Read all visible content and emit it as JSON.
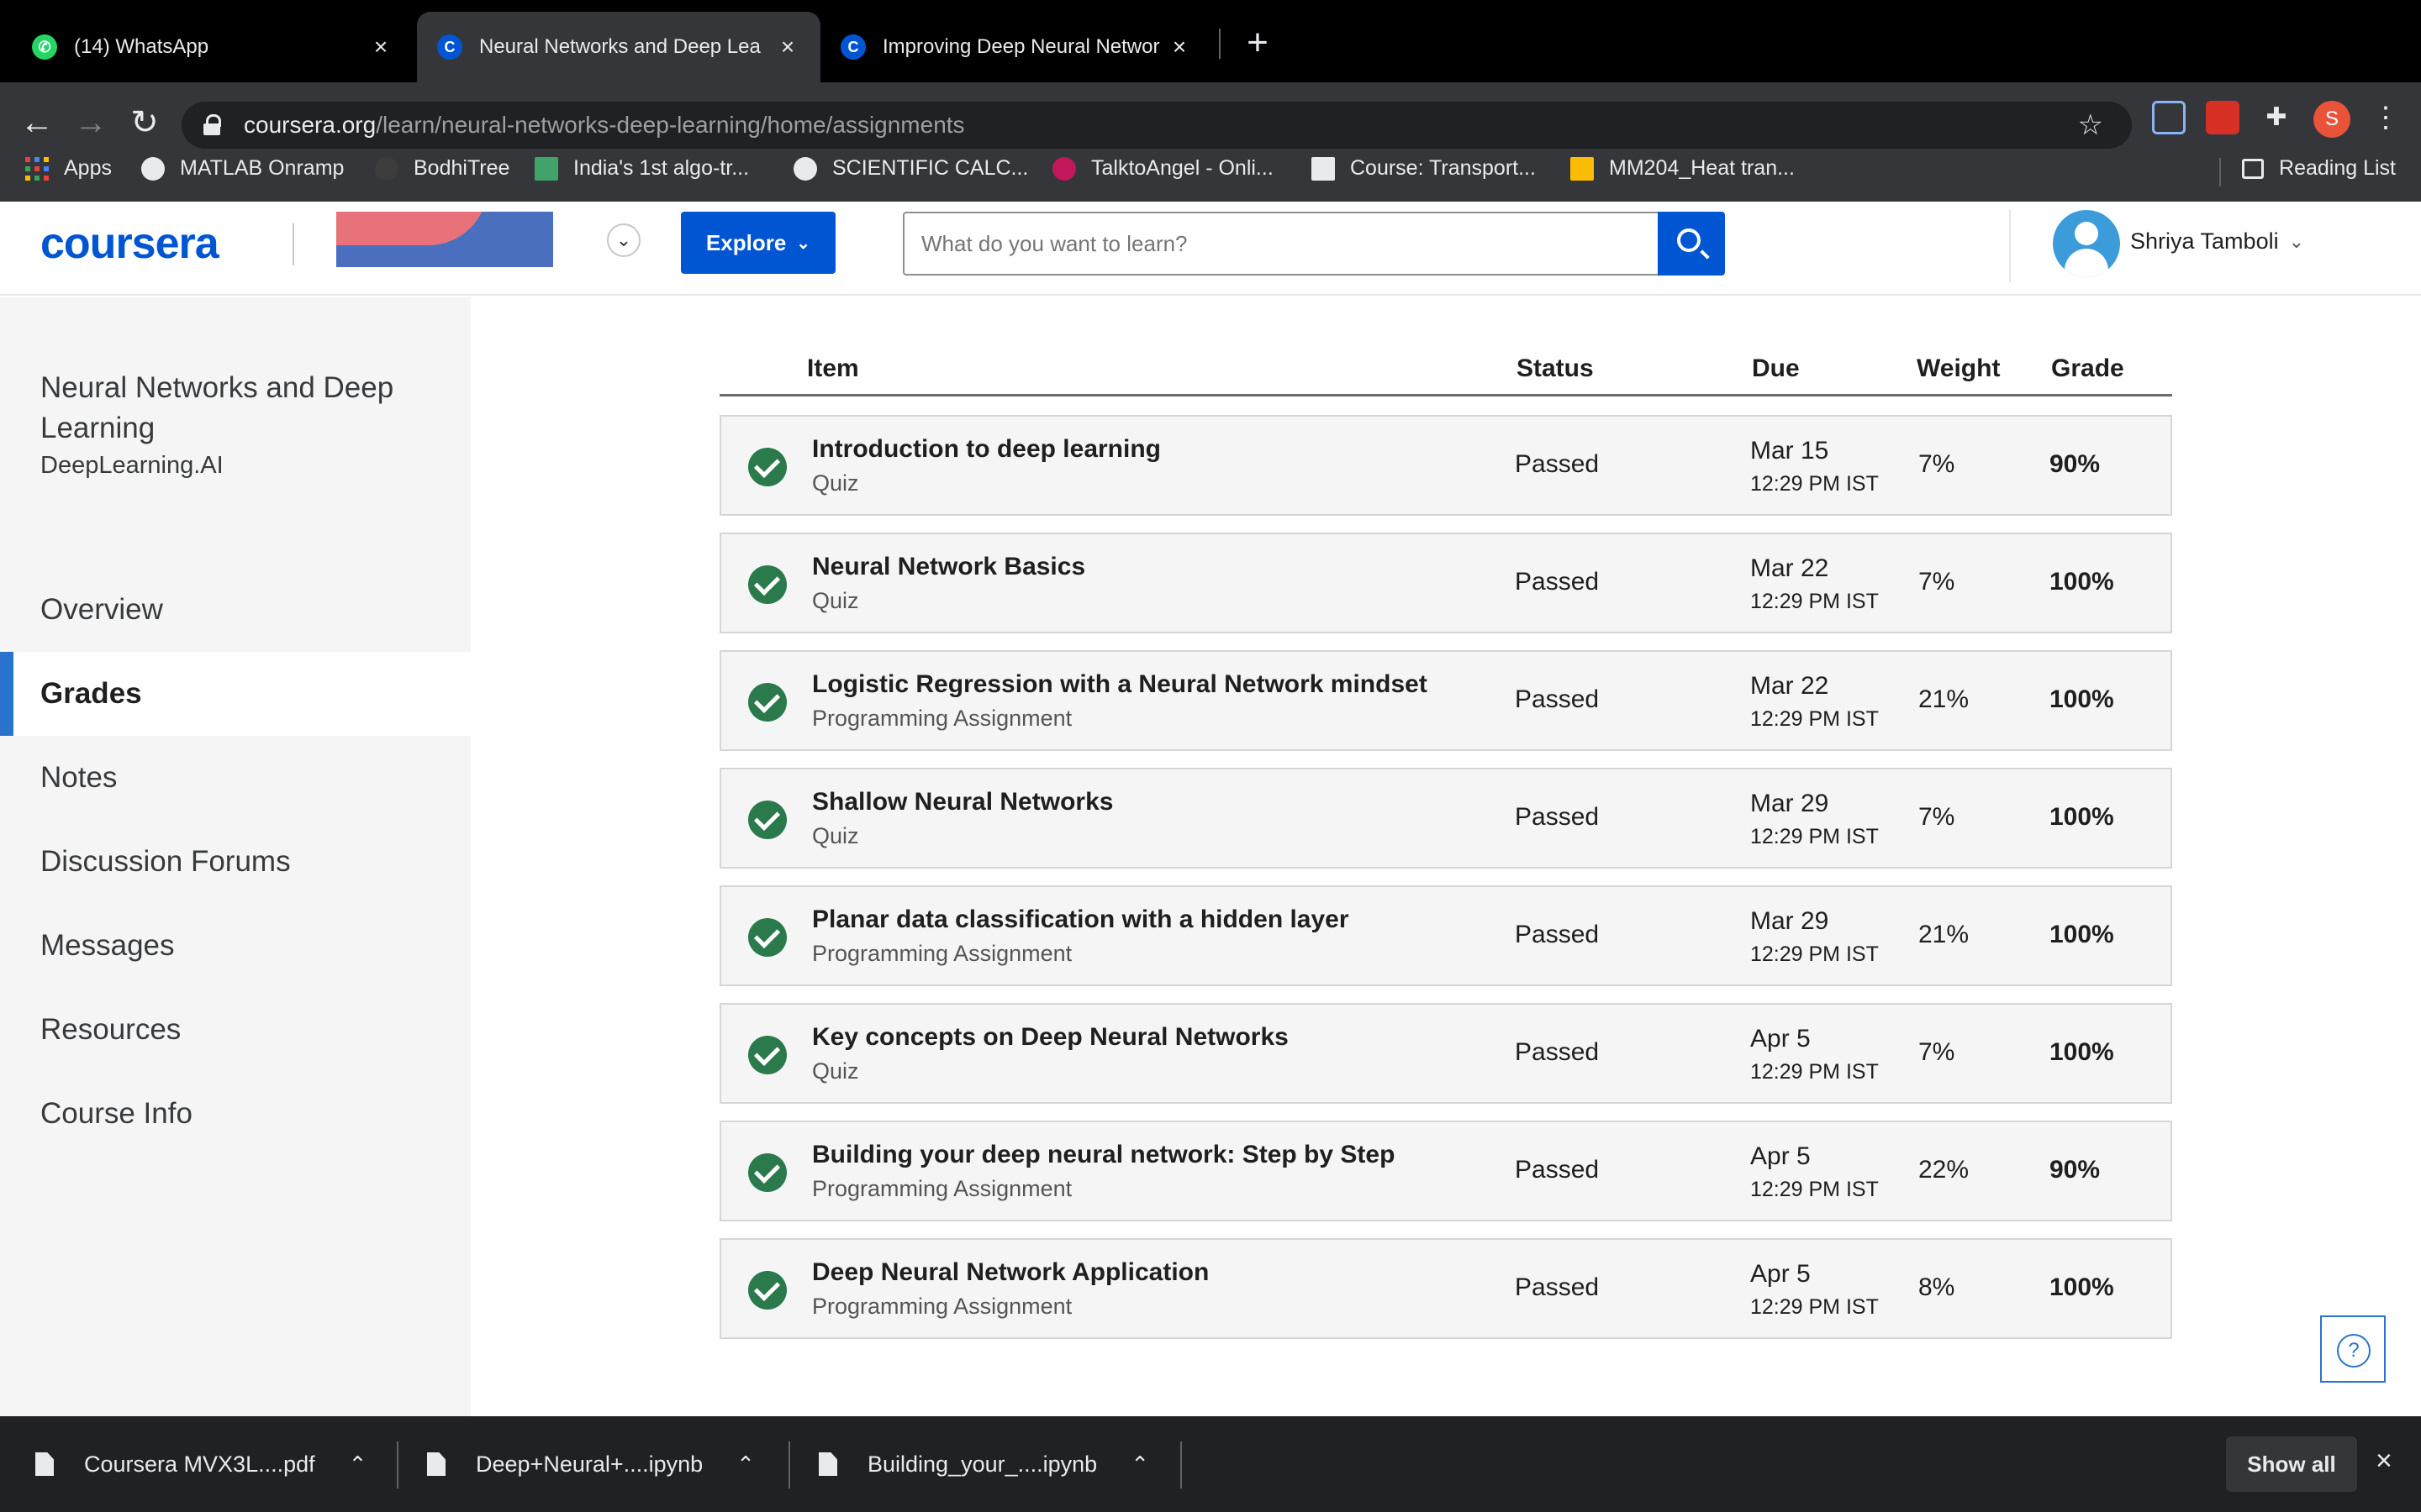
{
  "browser": {
    "tabs": [
      {
        "title": "(14) WhatsApp",
        "favicon": "whatsapp-icon",
        "favicon_color": "#25d366"
      },
      {
        "title": "Neural Networks and Deep Lea",
        "favicon": "coursera-icon",
        "favicon_color": "#0056d2"
      },
      {
        "title": "Improving Deep Neural Networ",
        "favicon": "coursera-icon",
        "favicon_color": "#0056d2"
      }
    ],
    "url_host": "coursera.org",
    "url_path": "/learn/neural-networks-deep-learning/home/assignments",
    "profile_initial": "S",
    "bookmarks": [
      {
        "label": "Apps"
      },
      {
        "label": "MATLAB Onramp"
      },
      {
        "label": "BodhiTree"
      },
      {
        "label": "India's 1st algo-tr..."
      },
      {
        "label": "SCIENTIFIC CALC..."
      },
      {
        "label": "TalktoAngel - Onli..."
      },
      {
        "label": "Course: Transport..."
      },
      {
        "label": "MM204_Heat tran..."
      }
    ],
    "reading_list": "Reading List"
  },
  "header": {
    "logo": "coursera",
    "explore_label": "Explore",
    "search_placeholder": "What do you want to learn?",
    "user_name": "Shriya Tamboli"
  },
  "sidebar": {
    "course_title": "Neural Networks and Deep Learning",
    "course_org": "DeepLearning.AI",
    "items": [
      {
        "label": "Overview"
      },
      {
        "label": "Grades"
      },
      {
        "label": "Notes"
      },
      {
        "label": "Discussion Forums"
      },
      {
        "label": "Messages"
      },
      {
        "label": "Resources"
      },
      {
        "label": "Course Info"
      }
    ],
    "active": "Grades"
  },
  "grades": {
    "columns": {
      "item": "Item",
      "status": "Status",
      "due": "Due",
      "weight": "Weight",
      "grade": "Grade"
    },
    "rows": [
      {
        "name": "Introduction to deep learning",
        "type": "Quiz",
        "status": "Passed",
        "due_date": "Mar 15",
        "due_time": "12:29 PM IST",
        "weight": "7%",
        "grade": "90%"
      },
      {
        "name": "Neural Network Basics",
        "type": "Quiz",
        "status": "Passed",
        "due_date": "Mar 22",
        "due_time": "12:29 PM IST",
        "weight": "7%",
        "grade": "100%"
      },
      {
        "name": "Logistic Regression with a Neural Network mindset",
        "type": "Programming Assignment",
        "status": "Passed",
        "due_date": "Mar 22",
        "due_time": "12:29 PM IST",
        "weight": "21%",
        "grade": "100%"
      },
      {
        "name": "Shallow Neural Networks",
        "type": "Quiz",
        "status": "Passed",
        "due_date": "Mar 29",
        "due_time": "12:29 PM IST",
        "weight": "7%",
        "grade": "100%"
      },
      {
        "name": "Planar data classification with a hidden layer",
        "type": "Programming Assignment",
        "status": "Passed",
        "due_date": "Mar 29",
        "due_time": "12:29 PM IST",
        "weight": "21%",
        "grade": "100%"
      },
      {
        "name": "Key concepts on Deep Neural Networks",
        "type": "Quiz",
        "status": "Passed",
        "due_date": "Apr 5",
        "due_time": "12:29 PM IST",
        "weight": "7%",
        "grade": "100%"
      },
      {
        "name": "Building your deep neural network: Step by Step",
        "type": "Programming Assignment",
        "status": "Passed",
        "due_date": "Apr 5",
        "due_time": "12:29 PM IST",
        "weight": "22%",
        "grade": "90%"
      },
      {
        "name": "Deep Neural Network Application",
        "type": "Programming Assignment",
        "status": "Passed",
        "due_date": "Apr 5",
        "due_time": "12:29 PM IST",
        "weight": "8%",
        "grade": "100%"
      }
    ]
  },
  "downloads": {
    "files": [
      {
        "name": "Coursera MVX3L....pdf"
      },
      {
        "name": "Deep+Neural+....ipynb"
      },
      {
        "name": "Building_your_....ipynb"
      }
    ],
    "show_all": "Show all"
  },
  "colors": {
    "brand": "#0056d2",
    "passed_check": "#2a7a4b",
    "active_nav_bar": "#2a73cc"
  }
}
